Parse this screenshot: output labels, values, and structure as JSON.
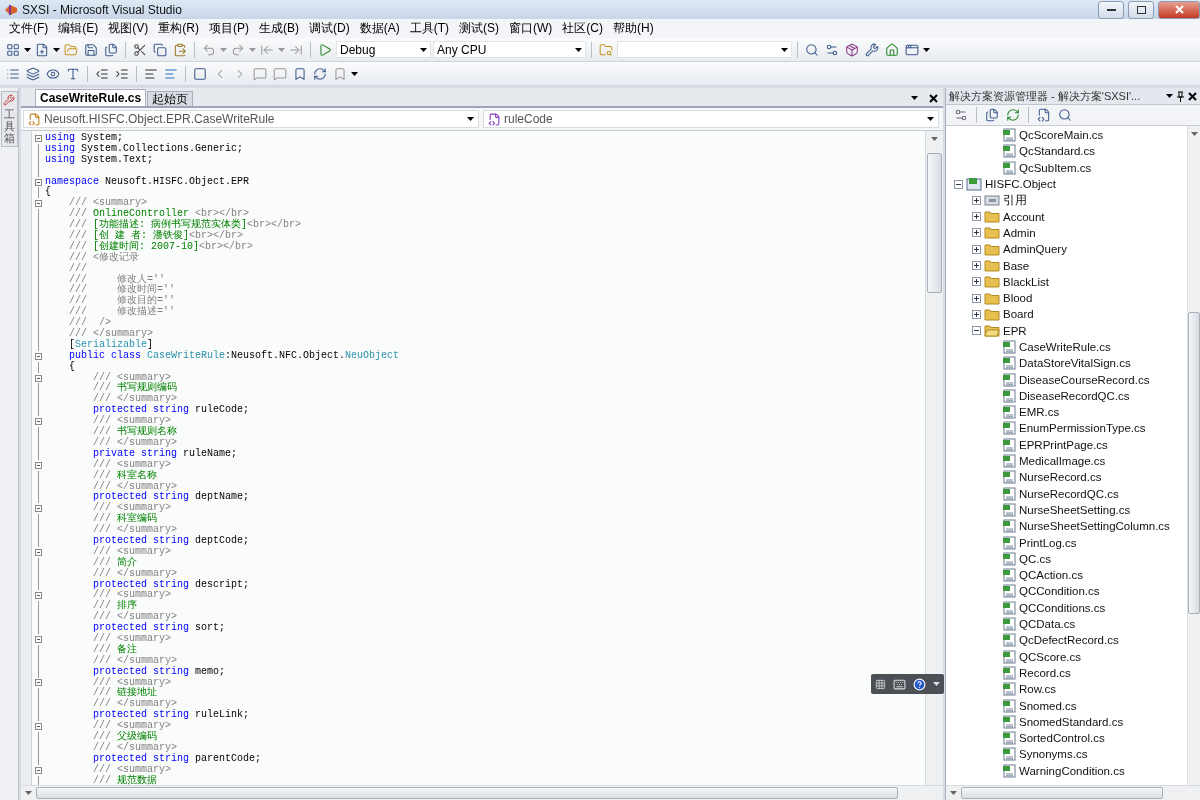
{
  "window": {
    "title": "SXSI - Microsoft Visual Studio"
  },
  "menu": [
    "文件(F)",
    "编辑(E)",
    "视图(V)",
    "重构(R)",
    "项目(P)",
    "生成(B)",
    "调试(D)",
    "数据(A)",
    "工具(T)",
    "测试(S)",
    "窗口(W)",
    "社区(C)",
    "帮助(H)"
  ],
  "toolbar": {
    "configuration": "Debug",
    "platform": "Any CPU"
  },
  "toolbox": {
    "label": "工具箱"
  },
  "editor": {
    "tabs": [
      {
        "label": "CaseWriteRule.cs",
        "selected": true
      },
      {
        "label": "起始页",
        "selected": false
      }
    ],
    "type_dropdown": "Neusoft.HISFC.Object.EPR.CaseWriteRule",
    "member_dropdown": "ruleCode",
    "lines": [
      {
        "fold": true,
        "tokens": [
          {
            "kind": "kw",
            "text": "using"
          },
          {
            "kind": "text",
            "text": " System;"
          }
        ]
      },
      {
        "fold": false,
        "tokens": [
          {
            "kind": "kw",
            "text": "using"
          },
          {
            "kind": "text",
            "text": " System.Collections.Generic;"
          }
        ]
      },
      {
        "fold": false,
        "tokens": [
          {
            "kind": "kw",
            "text": "using"
          },
          {
            "kind": "text",
            "text": " System.Text;"
          }
        ]
      },
      {
        "fold": false
      },
      {
        "fold": true,
        "tokens": [
          {
            "kind": "kw",
            "text": "namespace"
          },
          {
            "kind": "text",
            "text": " Neusoft.HISFC.Object.EPR"
          }
        ]
      },
      {
        "fold": false,
        "tokens": [
          {
            "kind": "text",
            "text": "{"
          }
        ]
      },
      {
        "fold": true,
        "tokens": [
          {
            "kind": "doc",
            "text": "    /// <summary>"
          }
        ]
      },
      {
        "fold": false,
        "tokens": [
          {
            "kind": "doc",
            "text": "    /// "
          },
          {
            "kind": "comment",
            "text": "OnlineController "
          },
          {
            "kind": "doc",
            "text": "<br></br>"
          }
        ]
      },
      {
        "fold": false,
        "tokens": [
          {
            "kind": "doc",
            "text": "    /// "
          },
          {
            "kind": "comment",
            "text": "[功能描述: 病例书写规范实体类]"
          },
          {
            "kind": "doc",
            "text": "<br></br>"
          }
        ]
      },
      {
        "fold": false,
        "tokens": [
          {
            "kind": "doc",
            "text": "    /// "
          },
          {
            "kind": "comment",
            "text": "[创 建 者: 潘铁俊]"
          },
          {
            "kind": "doc",
            "text": "<br></br>"
          }
        ]
      },
      {
        "fold": false,
        "tokens": [
          {
            "kind": "doc",
            "text": "    /// "
          },
          {
            "kind": "comment",
            "text": "[创建时间: 2007-10]"
          },
          {
            "kind": "doc",
            "text": "<br></br>"
          }
        ]
      },
      {
        "fold": false,
        "tokens": [
          {
            "kind": "doc",
            "text": "    /// <修改记录"
          }
        ]
      },
      {
        "fold": false,
        "tokens": [
          {
            "kind": "doc",
            "text": "    ///"
          }
        ]
      },
      {
        "fold": false,
        "tokens": [
          {
            "kind": "doc",
            "text": "    ///     修改人=''"
          }
        ]
      },
      {
        "fold": false,
        "tokens": [
          {
            "kind": "doc",
            "text": "    ///     修改时间=''"
          }
        ]
      },
      {
        "fold": false,
        "tokens": [
          {
            "kind": "doc",
            "text": "    ///     修改目的=''"
          }
        ]
      },
      {
        "fold": false,
        "tokens": [
          {
            "kind": "doc",
            "text": "    ///     修改描述=''"
          }
        ]
      },
      {
        "fold": false,
        "tokens": [
          {
            "kind": "doc",
            "text": "    ///  />"
          }
        ]
      },
      {
        "fold": false,
        "tokens": [
          {
            "kind": "doc",
            "text": "    /// </summary>"
          }
        ]
      },
      {
        "fold": false,
        "tokens": [
          {
            "kind": "text",
            "text": "    ["
          },
          {
            "kind": "type",
            "text": "Serializable"
          },
          {
            "kind": "text",
            "text": "]"
          }
        ]
      },
      {
        "fold": true,
        "tokens": [
          {
            "kind": "kw",
            "text": "    public class "
          },
          {
            "kind": "type",
            "text": "CaseWriteRule"
          },
          {
            "kind": "text",
            "text": ":Neusoft.NFC.Object."
          },
          {
            "kind": "type",
            "text": "NeuObject"
          }
        ]
      },
      {
        "fold": false,
        "tokens": [
          {
            "kind": "text",
            "text": "    {"
          }
        ]
      },
      {
        "fold": true,
        "tokens": [
          {
            "kind": "doc",
            "text": "        /// <summary>"
          }
        ]
      },
      {
        "fold": false,
        "tokens": [
          {
            "kind": "doc",
            "text": "        /// "
          },
          {
            "kind": "comment",
            "text": "书写规则编码"
          }
        ]
      },
      {
        "fold": false,
        "tokens": [
          {
            "kind": "doc",
            "text": "        /// </summary>"
          }
        ]
      },
      {
        "fold": false,
        "tokens": [
          {
            "kind": "kw",
            "text": "        protected string"
          },
          {
            "kind": "text",
            "text": " ruleCode;"
          }
        ]
      },
      {
        "fold": true,
        "tokens": [
          {
            "kind": "doc",
            "text": "        /// <summary>"
          }
        ]
      },
      {
        "fold": false,
        "tokens": [
          {
            "kind": "doc",
            "text": "        /// "
          },
          {
            "kind": "comment",
            "text": "书写规则名称"
          }
        ]
      },
      {
        "fold": false,
        "tokens": [
          {
            "kind": "doc",
            "text": "        /// </summary>"
          }
        ]
      },
      {
        "fold": false,
        "tokens": [
          {
            "kind": "kw",
            "text": "        private string"
          },
          {
            "kind": "text",
            "text": " ruleName;"
          }
        ]
      },
      {
        "fold": true,
        "tokens": [
          {
            "kind": "doc",
            "text": "        /// <summary>"
          }
        ]
      },
      {
        "fold": false,
        "tokens": [
          {
            "kind": "doc",
            "text": "        /// "
          },
          {
            "kind": "comment",
            "text": "科室名称"
          }
        ]
      },
      {
        "fold": false,
        "tokens": [
          {
            "kind": "doc",
            "text": "        /// </summary>"
          }
        ]
      },
      {
        "fold": false,
        "tokens": [
          {
            "kind": "kw",
            "text": "        protected string"
          },
          {
            "kind": "text",
            "text": " deptName;"
          }
        ]
      },
      {
        "fold": true,
        "tokens": [
          {
            "kind": "doc",
            "text": "        /// <summary>"
          }
        ]
      },
      {
        "fold": false,
        "tokens": [
          {
            "kind": "doc",
            "text": "        /// "
          },
          {
            "kind": "comment",
            "text": "科室编码"
          }
        ]
      },
      {
        "fold": false,
        "tokens": [
          {
            "kind": "doc",
            "text": "        /// </summary>"
          }
        ]
      },
      {
        "fold": false,
        "tokens": [
          {
            "kind": "kw",
            "text": "        protected string"
          },
          {
            "kind": "text",
            "text": " deptCode;"
          }
        ]
      },
      {
        "fold": true,
        "tokens": [
          {
            "kind": "doc",
            "text": "        /// <summary>"
          }
        ]
      },
      {
        "fold": false,
        "tokens": [
          {
            "kind": "doc",
            "text": "        /// "
          },
          {
            "kind": "comment",
            "text": "简介"
          }
        ]
      },
      {
        "fold": false,
        "tokens": [
          {
            "kind": "doc",
            "text": "        /// </summary>"
          }
        ]
      },
      {
        "fold": false,
        "tokens": [
          {
            "kind": "kw",
            "text": "        protected string"
          },
          {
            "kind": "text",
            "text": " descript;"
          }
        ]
      },
      {
        "fold": true,
        "tokens": [
          {
            "kind": "doc",
            "text": "        /// <summary>"
          }
        ]
      },
      {
        "fold": false,
        "tokens": [
          {
            "kind": "doc",
            "text": "        /// "
          },
          {
            "kind": "comment",
            "text": "排序"
          }
        ]
      },
      {
        "fold": false,
        "tokens": [
          {
            "kind": "doc",
            "text": "        /// </summary>"
          }
        ]
      },
      {
        "fold": false,
        "tokens": [
          {
            "kind": "kw",
            "text": "        protected string"
          },
          {
            "kind": "text",
            "text": " sort;"
          }
        ]
      },
      {
        "fold": true,
        "tokens": [
          {
            "kind": "doc",
            "text": "        /// <summary>"
          }
        ]
      },
      {
        "fold": false,
        "tokens": [
          {
            "kind": "doc",
            "text": "        /// "
          },
          {
            "kind": "comment",
            "text": "备注"
          }
        ]
      },
      {
        "fold": false,
        "tokens": [
          {
            "kind": "doc",
            "text": "        /// </summary>"
          }
        ]
      },
      {
        "fold": false,
        "tokens": [
          {
            "kind": "kw",
            "text": "        protected string"
          },
          {
            "kind": "text",
            "text": " memo;"
          }
        ]
      },
      {
        "fold": true,
        "tokens": [
          {
            "kind": "doc",
            "text": "        /// <summary>"
          }
        ]
      },
      {
        "fold": false,
        "tokens": [
          {
            "kind": "doc",
            "text": "        /// "
          },
          {
            "kind": "comment",
            "text": "链接地址"
          }
        ]
      },
      {
        "fold": false,
        "tokens": [
          {
            "kind": "doc",
            "text": "        /// </summary>"
          }
        ]
      },
      {
        "fold": false,
        "tokens": [
          {
            "kind": "kw",
            "text": "        protected string"
          },
          {
            "kind": "text",
            "text": " ruleLink;"
          }
        ]
      },
      {
        "fold": true,
        "tokens": [
          {
            "kind": "doc",
            "text": "        /// <summary>"
          }
        ]
      },
      {
        "fold": false,
        "tokens": [
          {
            "kind": "doc",
            "text": "        /// "
          },
          {
            "kind": "comment",
            "text": "父级编码"
          }
        ]
      },
      {
        "fold": false,
        "tokens": [
          {
            "kind": "doc",
            "text": "        /// </summary>"
          }
        ]
      },
      {
        "fold": false,
        "tokens": [
          {
            "kind": "kw",
            "text": "        protected string"
          },
          {
            "kind": "text",
            "text": " parentCode;"
          }
        ]
      },
      {
        "fold": true,
        "tokens": [
          {
            "kind": "doc",
            "text": "        /// <summary>"
          }
        ]
      },
      {
        "fold": false,
        "tokens": [
          {
            "kind": "doc",
            "text": "        /// "
          },
          {
            "kind": "comment",
            "text": "规范数据"
          }
        ]
      }
    ]
  },
  "solution_explorer": {
    "title": "解决方案资源管理器 - 解决方案'SXSI'...",
    "tree": [
      {
        "kind": "file",
        "label": "QcScoreMain.cs"
      },
      {
        "kind": "file",
        "label": "QcStandard.cs"
      },
      {
        "kind": "file",
        "label": "QcSubItem.cs"
      },
      {
        "kind": "project",
        "label": "HISFC.Object",
        "expanded": true,
        "children": [
          {
            "kind": "references",
            "label": "引用",
            "expanded": false
          },
          {
            "kind": "folder",
            "label": "Account",
            "expanded": false
          },
          {
            "kind": "folder",
            "label": "Admin",
            "expanded": false
          },
          {
            "kind": "folder",
            "label": "AdminQuery",
            "expanded": false
          },
          {
            "kind": "folder",
            "label": "Base",
            "expanded": false
          },
          {
            "kind": "folder",
            "label": "BlackList",
            "expanded": false
          },
          {
            "kind": "folder",
            "label": "Blood",
            "expanded": false
          },
          {
            "kind": "folder",
            "label": "Board",
            "expanded": false
          },
          {
            "kind": "folder",
            "label": "EPR",
            "expanded": true,
            "children": [
              {
                "kind": "file",
                "label": "CaseWriteRule.cs"
              },
              {
                "kind": "file",
                "label": "DataStoreVitalSign.cs"
              },
              {
                "kind": "file",
                "label": "DiseaseCourseRecord.cs"
              },
              {
                "kind": "file",
                "label": "DiseaseRecordQC.cs"
              },
              {
                "kind": "file",
                "label": "EMR.cs"
              },
              {
                "kind": "file",
                "label": "EnumPermissionType.cs"
              },
              {
                "kind": "file",
                "label": "EPRPrintPage.cs"
              },
              {
                "kind": "file",
                "label": "MedicalImage.cs"
              },
              {
                "kind": "file",
                "label": "NurseRecord.cs"
              },
              {
                "kind": "file",
                "label": "NurseRecordQC.cs"
              },
              {
                "kind": "file",
                "label": "NurseSheetSetting.cs"
              },
              {
                "kind": "file",
                "label": "NurseSheetSettingColumn.cs"
              },
              {
                "kind": "file",
                "label": "PrintLog.cs"
              },
              {
                "kind": "file",
                "label": "QC.cs"
              },
              {
                "kind": "file",
                "label": "QCAction.cs"
              },
              {
                "kind": "file",
                "label": "QCCondition.cs"
              },
              {
                "kind": "file",
                "label": "QCConditions.cs"
              },
              {
                "kind": "file",
                "label": "QCData.cs"
              },
              {
                "kind": "file",
                "label": "QcDefectRecord.cs"
              },
              {
                "kind": "file",
                "label": "QCScore.cs"
              },
              {
                "kind": "file",
                "label": "Record.cs"
              },
              {
                "kind": "file",
                "label": "Row.cs"
              },
              {
                "kind": "file",
                "label": "Snomed.cs"
              },
              {
                "kind": "file",
                "label": "SnomedStandard.cs"
              },
              {
                "kind": "file",
                "label": "SortedControl.cs"
              },
              {
                "kind": "file",
                "label": "Synonyms.cs"
              },
              {
                "kind": "file",
                "label": "WarningCondition.cs"
              }
            ]
          }
        ]
      }
    ]
  }
}
